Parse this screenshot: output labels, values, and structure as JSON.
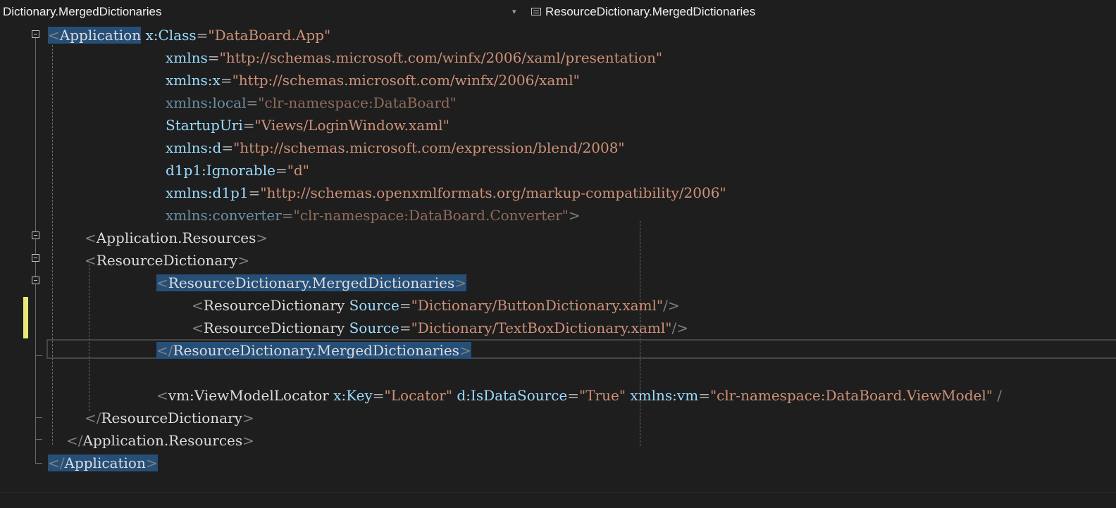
{
  "navbar": {
    "left_scope": "Dictionary.MergedDictionaries",
    "right_scope": "ResourceDictionary.MergedDictionaries",
    "right_icon": "xaml-element-icon"
  },
  "colors": {
    "background": "#1e1e1e",
    "element": "#dcdcdc",
    "attribute": "#9cdcfe",
    "string": "#ce9178",
    "selection": "#264f78",
    "change_bar": "#e9e97a"
  },
  "code": {
    "l1": {
      "lt": "<",
      "tag": "Application",
      "a1": "x:Class",
      "eq": "=",
      "v1": "\"DataBoard.App\""
    },
    "l2": {
      "a": "xmlns",
      "eq": "=",
      "v": "\"http://schemas.microsoft.com/winfx/2006/xaml/presentation\""
    },
    "l3": {
      "a": "xmlns:x",
      "eq": "=",
      "v": "\"http://schemas.microsoft.com/winfx/2006/xaml\""
    },
    "l4": {
      "a": "xmlns:local",
      "eq": "=",
      "v": "\"clr-namespace:DataBoard\""
    },
    "l5": {
      "a": "StartupUri",
      "eq": "=",
      "v": "\"Views/LoginWindow.xaml\""
    },
    "l6": {
      "a": "xmlns:d",
      "eq": "=",
      "v": "\"http://schemas.microsoft.com/expression/blend/2008\""
    },
    "l7": {
      "a": "d1p1:Ignorable",
      "eq": "=",
      "v": "\"d\""
    },
    "l8": {
      "a": "xmlns:d1p1",
      "eq": "=",
      "v": "\"http://schemas.openxmlformats.org/markup-compatibility/2006\""
    },
    "l9": {
      "a": "xmlns:converter",
      "eq": "=",
      "v": "\"clr-namespace:DataBoard.Converter\"",
      "gt": ">"
    },
    "l10": {
      "lt": "<",
      "tag": "Application.Resources",
      "gt": ">"
    },
    "l11": {
      "lt": "<",
      "tag": "ResourceDictionary",
      "gt": ">"
    },
    "l12": {
      "lt": "<",
      "tag": "ResourceDictionary.MergedDictionaries",
      "gt": ">"
    },
    "l13": {
      "lt": "<",
      "tag": "ResourceDictionary",
      "a": "Source",
      "eq": "=",
      "v": "\"Dictionary/ButtonDictionary.xaml\"",
      "end": "/>"
    },
    "l14": {
      "lt": "<",
      "tag": "ResourceDictionary",
      "a": "Source",
      "eq": "=",
      "v": "\"Dictionary/TextBoxDictionary.xaml\"",
      "end": "/>"
    },
    "l15": {
      "lt": "</",
      "tag": "ResourceDictionary.MergedDictionaries",
      "gt": ">"
    },
    "l17": {
      "lt": "<",
      "tag": "vm:ViewModelLocator",
      "a1": "x:Key",
      "eq1": "=",
      "v1": "\"Locator\"",
      "a2": "d:IsDataSource",
      "eq2": "=",
      "v2": "\"True\"",
      "a3": "xmlns:vm",
      "eq3": "=",
      "v3": "\"clr-namespace:DataBoard.ViewModel\"",
      "tail": " /"
    },
    "l18": {
      "lt": "</",
      "tag": "ResourceDictionary",
      "gt": ">"
    },
    "l19": {
      "lt": "</",
      "tag": "Application.Resources",
      "gt": ">"
    },
    "l20": {
      "lt": "</",
      "tag": "Application",
      "gt": ">"
    }
  }
}
